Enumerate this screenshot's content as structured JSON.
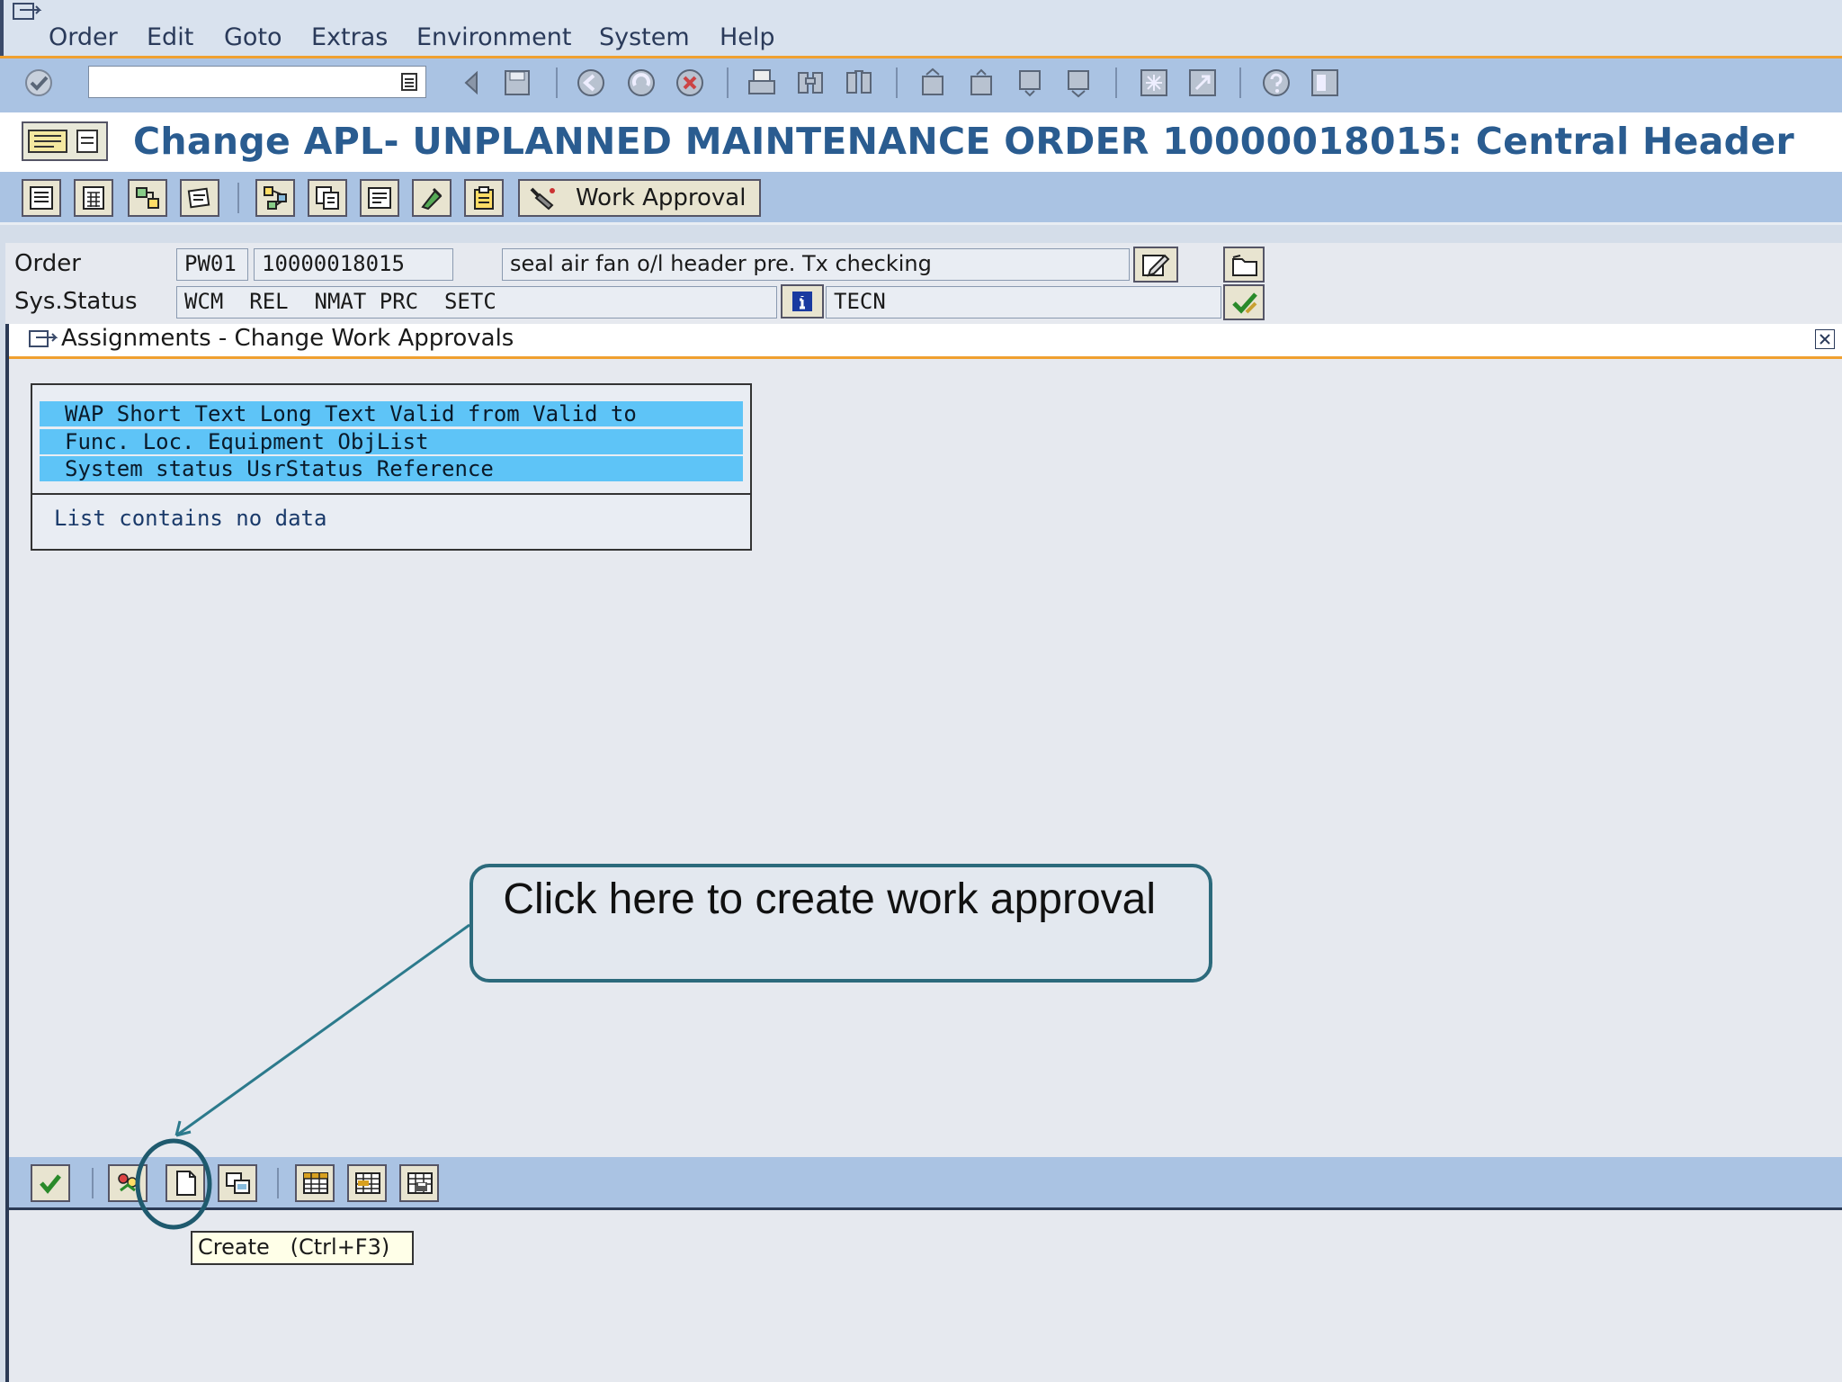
{
  "menu": {
    "items": [
      "Order",
      "Edit",
      "Goto",
      "Extras",
      "Environment",
      "System",
      "Help"
    ]
  },
  "command_field": {
    "value": ""
  },
  "title": "Change APL- UNPLANNED MAINTENANCE ORDER 10000018015: Central Header",
  "app_toolbar": {
    "work_approval_label": "Work Approval"
  },
  "header": {
    "order_label": "Order",
    "order_type": "PW01",
    "order_number": "10000018015",
    "order_description": "seal air fan o/l header pre. Tx checking",
    "sys_status_label": "Sys.Status",
    "sys_status": "WCM  REL  NMAT PRC  SETC",
    "user_status": "TECN"
  },
  "popup": {
    "title": "Assignments - Change Work Approvals",
    "columns_row1": "WAP Short Text Long Text Valid from Valid to",
    "columns_row2": "Func. Loc. Equipment ObjList",
    "columns_row3": "System status UsrStatus Reference",
    "empty_message": "List contains no data"
  },
  "tooltip": "Create   (Ctrl+F3)",
  "callout": {
    "text": " Click here to create work approval"
  },
  "colors": {
    "toolbar_blue": "#aac3e3",
    "title_blue": "#2a5c90",
    "accent_orange": "#f0a030",
    "list_header_cyan": "#5ec4f7",
    "callout_border": "#2c6a7c"
  }
}
